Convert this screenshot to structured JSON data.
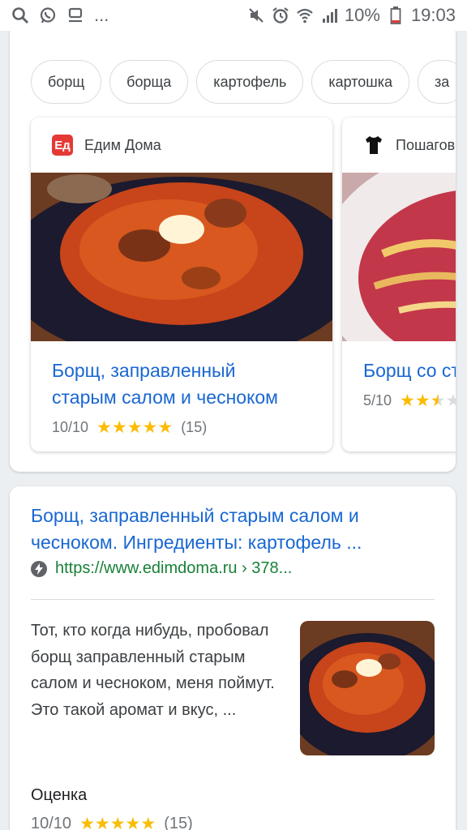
{
  "status_bar": {
    "left_icons": [
      "search-icon",
      "whatsapp-icon",
      "message-icon"
    ],
    "overflow": "...",
    "battery_percent": "10%",
    "time": "19:03"
  },
  "chips": [
    "борщ",
    "борща",
    "картофель",
    "картошка",
    "за"
  ],
  "recipes": [
    {
      "source": "Едим Дома",
      "source_logo": "Ед",
      "title_line1": "Борщ, заправленный",
      "title_line2": "старым салом и чесноком",
      "rating": "10/10",
      "stars_full": 5,
      "reviews": "(15)"
    },
    {
      "source": "Пошаговы",
      "title_line1": "Борщ со ст",
      "rating": "5/10",
      "stars_full": 2.5
    }
  ],
  "result": {
    "title": "Борщ, заправленный старым салом и чесноком. Ингредиенты: картофель ...",
    "url": "https://www.edimdoma.ru › 378...",
    "snippet": "Тот, кто когда нибудь, пробовал борщ заправленный старым салом и чесноком, меня поймут. Это такой аромат и вкус, ...",
    "rating_label": "Оценка",
    "rating": "10/10",
    "reviews": "(15)"
  },
  "colors": {
    "link": "#1967d2",
    "url_green": "#188038",
    "star": "#fbbc04",
    "brand_red": "#e53935"
  }
}
